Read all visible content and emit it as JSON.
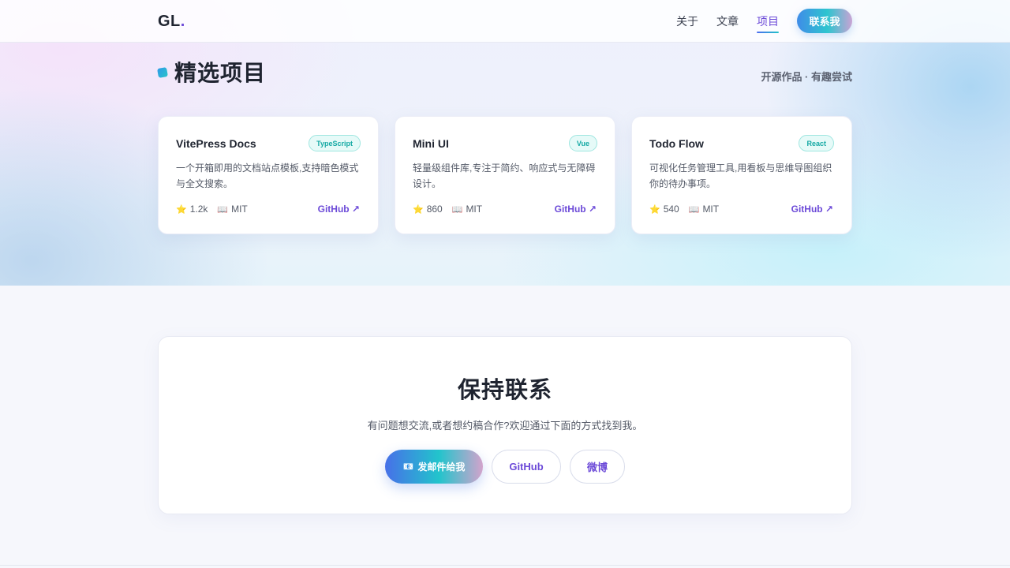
{
  "header": {
    "logo_text": "GL",
    "logo_dot": ".",
    "nav": [
      {
        "label": "关于",
        "active": false
      },
      {
        "label": "文章",
        "active": false
      },
      {
        "label": "项目",
        "active": true
      }
    ],
    "contact_label": "联系我"
  },
  "projects": {
    "title": "精选项目",
    "subtitle": "开源作品 · 有趣尝试",
    "cards": [
      {
        "title": "VitePress Docs",
        "tag": "TypeScript",
        "desc": "一个开箱即用的文档站点模板,支持暗色模式与全文搜索。",
        "star_icon": "⭐",
        "stars": "1.2k",
        "license_icon": "📖",
        "license": "MIT",
        "link": "GitHub ↗"
      },
      {
        "title": "Mini UI",
        "tag": "Vue",
        "desc": "轻量级组件库,专注于简约、响应式与无障碍设计。",
        "star_icon": "⭐",
        "stars": "860",
        "license_icon": "📖",
        "license": "MIT",
        "link": "GitHub ↗"
      },
      {
        "title": "Todo Flow",
        "tag": "React",
        "desc": "可视化任务管理工具,用看板与思维导图组织你的待办事项。",
        "star_icon": "⭐",
        "stars": "540",
        "license_icon": "📖",
        "license": "MIT",
        "link": "GitHub ↗"
      }
    ]
  },
  "contact": {
    "title": "保持联系",
    "desc": "有问题想交流,或者想约稿合作?欢迎通过下面的方式找到我。",
    "mail_icon": "📧",
    "mail_label": "发邮件给我",
    "github_label": "GitHub",
    "weibo_label": "微博"
  },
  "colors": {
    "accent": "#6c4ad8",
    "teal": "#22c4cc",
    "blue": "#4770e8"
  }
}
